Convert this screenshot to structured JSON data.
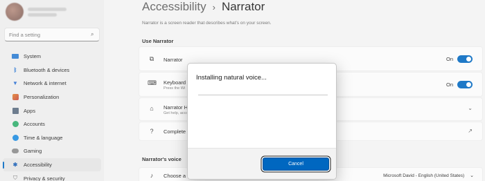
{
  "sidebar": {
    "search_placeholder": "Find a setting",
    "items": [
      {
        "label": "System",
        "icon": "monitor-icon"
      },
      {
        "label": "Bluetooth & devices",
        "icon": "bluetooth-icon"
      },
      {
        "label": "Network & internet",
        "icon": "wifi-icon"
      },
      {
        "label": "Personalization",
        "icon": "brush-icon"
      },
      {
        "label": "Apps",
        "icon": "apps-icon"
      },
      {
        "label": "Accounts",
        "icon": "person-icon"
      },
      {
        "label": "Time & language",
        "icon": "clock-globe-icon"
      },
      {
        "label": "Gaming",
        "icon": "gamepad-icon"
      },
      {
        "label": "Accessibility",
        "icon": "accessibility-icon",
        "active": true
      },
      {
        "label": "Privacy & security",
        "icon": "shield-icon"
      }
    ]
  },
  "header": {
    "breadcrumb_parent": "Accessibility",
    "breadcrumb_separator": "›",
    "page_title": "Narrator",
    "description": "Narrator is a screen reader that describes what's on your screen."
  },
  "use_narrator": {
    "heading": "Use Narrator",
    "narrator": {
      "label": "Narrator",
      "toggle_text": "On",
      "toggle_on": true
    },
    "keyboard_shortcut": {
      "label": "Keyboard s",
      "sub": "Press the Wi",
      "toggle_text": "On",
      "toggle_on": true
    },
    "narrator_home": {
      "label": "Narrator Ho",
      "sub": "Get help, acco"
    },
    "complete_guide": {
      "label": "Complete g"
    }
  },
  "narrators_voice": {
    "heading": "Narrator's voice",
    "choose_voice": {
      "label": "Choose a vo",
      "selected_voice": "Microsoft David - English (United States)"
    }
  },
  "dialog": {
    "title": "Installing natural voice...",
    "progress_percent": 0,
    "cancel_label": "Cancel"
  },
  "colors": {
    "accent": "#0067c0"
  }
}
